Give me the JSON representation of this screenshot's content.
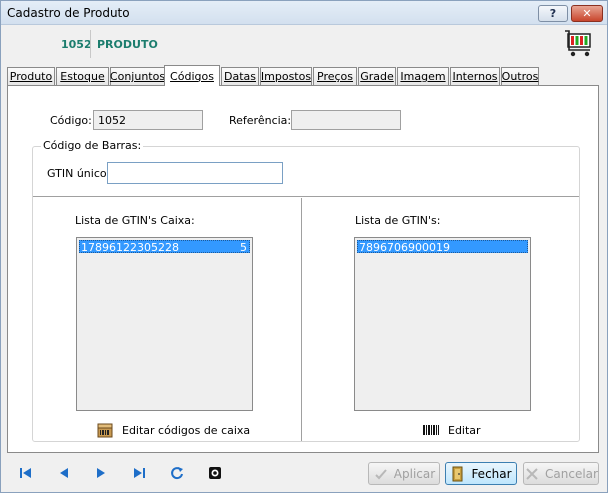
{
  "window": {
    "title": "Cadastro de Produto",
    "help_symbol": "?",
    "close_symbol": "✕"
  },
  "product": {
    "code": "1052",
    "name": "PRODUTO"
  },
  "tabs": [
    {
      "label": "Produto",
      "active": false
    },
    {
      "label": "Estoque",
      "active": false
    },
    {
      "label": "Conjuntos",
      "active": false
    },
    {
      "label": "Códigos",
      "active": true
    },
    {
      "label": "Datas",
      "active": false
    },
    {
      "label": "Impostos",
      "active": false
    },
    {
      "label": "Preços",
      "active": false
    },
    {
      "label": "Grade",
      "active": false
    },
    {
      "label": "Imagem",
      "active": false
    },
    {
      "label": "Internos",
      "active": false
    },
    {
      "label": "Outros",
      "active": false
    }
  ],
  "codes": {
    "codigo_label": "Código:",
    "codigo_value": "1052",
    "referencia_label": "Referência:",
    "referencia_value": "",
    "barcode_group_label": "Código de Barras:",
    "gtin_unico_label": "GTIN único:",
    "gtin_unico_value": "",
    "caixa_list_label": "Lista de GTIN's Caixa:",
    "caixa_items": [
      {
        "gtin": "17896122305228",
        "qty": "5",
        "selected": true
      }
    ],
    "gtin_list_label": "Lista de GTIN's:",
    "gtin_items": [
      {
        "gtin": "7896706900019",
        "selected": true
      }
    ],
    "edit_caixa_label": "Editar códigos de caixa",
    "edit_label": "Editar"
  },
  "footer": {
    "apply_label": "Aplicar",
    "close_label": "Fechar",
    "cancel_label": "Cancelar"
  },
  "colors": {
    "accent": "#1c7d6e",
    "selection": "#3399ff",
    "nav_icon": "#1e6ec8"
  }
}
